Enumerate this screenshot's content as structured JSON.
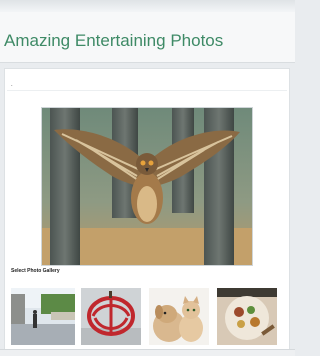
{
  "header": {
    "title": "Amazing Entertaining Photos"
  },
  "content": {
    "heading": ".",
    "gallery_label": "Select Photo Gallery",
    "thumbnails": [
      "street",
      "apple-sculpture",
      "puppy-and-kitten",
      "food-platter"
    ]
  },
  "colors": {
    "title": "#3e8a66",
    "background": "#e9ecef",
    "panel": "#ffffff"
  }
}
